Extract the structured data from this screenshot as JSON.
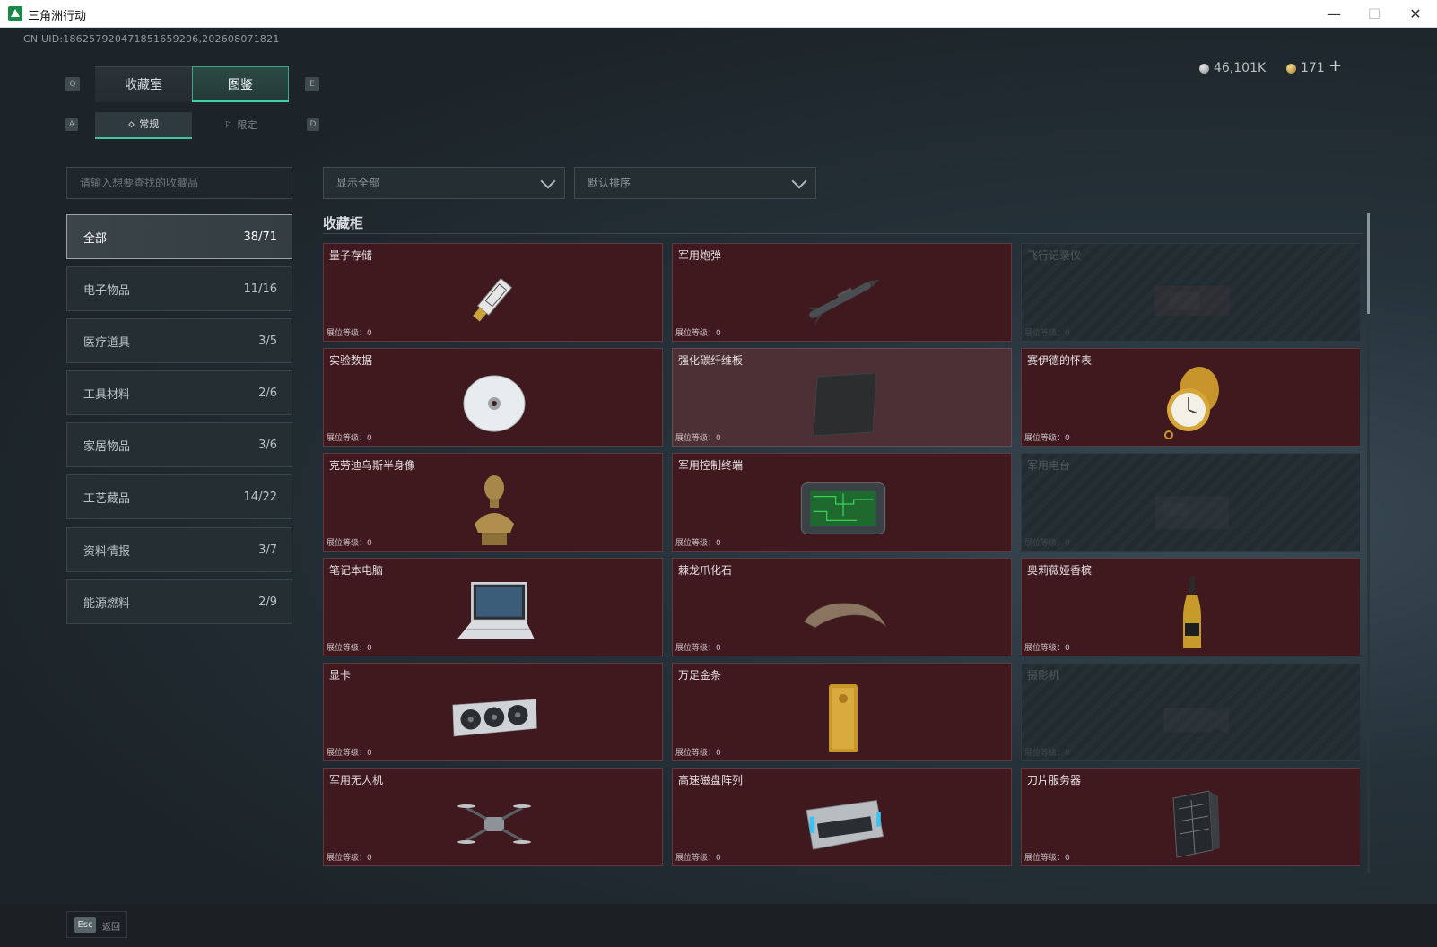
{
  "window": {
    "title": "三角洲行动",
    "min": "—",
    "max": "☐",
    "close": "✕"
  },
  "uid": "CN UID:1862579204718516592​06,202608071821",
  "currency": {
    "silver": "46,101K",
    "gold": "171",
    "plus": "+"
  },
  "keys": {
    "q": "Q",
    "e": "E",
    "a": "A",
    "d": "D"
  },
  "tabs": [
    {
      "label": "收藏室"
    },
    {
      "label": "图鉴"
    }
  ],
  "subtabs": [
    {
      "label": "常规",
      "icon": "🝔"
    },
    {
      "label": "限定",
      "icon": "⚐"
    }
  ],
  "search": {
    "placeholder": "请输入想要查找的收藏品"
  },
  "filters": {
    "show": "显示全部",
    "sort": "默认排序"
  },
  "categories": [
    {
      "label": "全部",
      "count": "38/71"
    },
    {
      "label": "电子物品",
      "count": "11/16"
    },
    {
      "label": "医疗道具",
      "count": "3/5"
    },
    {
      "label": "工具材料",
      "count": "2/6"
    },
    {
      "label": "家居物品",
      "count": "3/6"
    },
    {
      "label": "工艺藏品",
      "count": "14/22"
    },
    {
      "label": "资料情报",
      "count": "3/7"
    },
    {
      "label": "能源燃料",
      "count": "2/9"
    }
  ],
  "section": {
    "title": "收藏柜"
  },
  "level_label": "展位等级：0",
  "items": [
    {
      "name": "量子存储",
      "icon": "usb-drive-icon",
      "state": "owned"
    },
    {
      "name": "军用炮弹",
      "icon": "missile-icon",
      "state": "owned"
    },
    {
      "name": "飞行记录仪",
      "icon": "flight-recorder-icon",
      "state": "locked"
    },
    {
      "name": "实验数据",
      "icon": "disc-icon",
      "state": "owned"
    },
    {
      "name": "强化碳纤维板",
      "icon": "carbon-plate-icon",
      "state": "light"
    },
    {
      "name": "赛伊德的怀表",
      "icon": "pocket-watch-icon",
      "state": "owned"
    },
    {
      "name": "克劳迪乌斯半身像",
      "icon": "bust-icon",
      "state": "owned"
    },
    {
      "name": "军用控制终端",
      "icon": "control-terminal-icon",
      "state": "owned"
    },
    {
      "name": "军用电台",
      "icon": "radio-icon",
      "state": "locked"
    },
    {
      "name": "笔记本电脑",
      "icon": "laptop-icon",
      "state": "owned"
    },
    {
      "name": "棘龙爪化石",
      "icon": "claw-fossil-icon",
      "state": "owned"
    },
    {
      "name": "奥莉薇娅香槟",
      "icon": "champagne-icon",
      "state": "owned"
    },
    {
      "name": "显卡",
      "icon": "graphics-card-icon",
      "state": "owned"
    },
    {
      "name": "万足金条",
      "icon": "gold-bar-icon",
      "state": "owned"
    },
    {
      "name": "摄影机",
      "icon": "camera-icon",
      "state": "locked"
    },
    {
      "name": "军用无人机",
      "icon": "drone-icon",
      "state": "owned"
    },
    {
      "name": "高速磁盘阵列",
      "icon": "disk-array-icon",
      "state": "owned"
    },
    {
      "name": "刀片服务器",
      "icon": "blade-server-icon",
      "state": "owned"
    }
  ],
  "footer": {
    "esc_key": "Esc",
    "esc_label": "返回"
  }
}
